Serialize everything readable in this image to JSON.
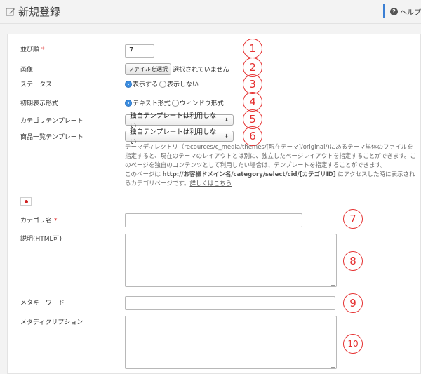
{
  "header": {
    "title": "新規登録",
    "help_label": "ヘルプ"
  },
  "form": {
    "order": {
      "label": "並び順",
      "required_mark": "*",
      "value": "7"
    },
    "image": {
      "label": "画像",
      "button": "ファイルを選択",
      "status": "選択されていません"
    },
    "status": {
      "label": "ステータス",
      "options": [
        "表示する",
        "表示しない"
      ],
      "selected": "表示する"
    },
    "initial_display": {
      "label": "初期表示形式",
      "options": [
        "テキスト形式",
        "ウィンドウ形式"
      ],
      "selected": "テキスト形式"
    },
    "category_template": {
      "label": "カテゴリテンプレート",
      "value": "独自テンプレートは利用しない"
    },
    "product_list_template": {
      "label": "商品一覧テンプレート",
      "value": "独自テンプレートは利用しない"
    },
    "template_note": {
      "line1": "テーマディレクトリ（recources/c_media/themes/[現在テーマ]/original/)にあるテーマ単体のファイルを",
      "line2": "指定すると、現在のテーマのレイアウトとは別に、独立したページレイアウトを指定することができます。こ",
      "line3": "のページを独自のコンテンツとして利用したい場合は、テンプレートを指定することができます。",
      "line4_pre": "このページは ",
      "line4_bold": "http://お客様ドメイン名/category/select/cid/[カテゴリID]",
      "line4_post": " にアクセスした時に表示され",
      "line5_pre": "るカテゴリページです。",
      "line5_link": "詳しくはこちら"
    },
    "category_name": {
      "label": "カテゴリ名",
      "required_mark": "*",
      "value": ""
    },
    "description": {
      "label": "説明(HTML可)",
      "value": ""
    },
    "meta_keywords": {
      "label": "メタキーワード",
      "value": ""
    },
    "meta_description": {
      "label": "メタディクリプション",
      "value": ""
    }
  },
  "annotations": [
    "1",
    "2",
    "3",
    "4",
    "5",
    "6",
    "7",
    "8",
    "9",
    "10"
  ],
  "colors": {
    "accent": "#3b7fd4",
    "annotation": "#e53030",
    "required": "#e03030"
  },
  "icons": {
    "title": "pencil-edit-icon",
    "help": "question-circle-icon",
    "flag": "japan-flag-icon"
  }
}
